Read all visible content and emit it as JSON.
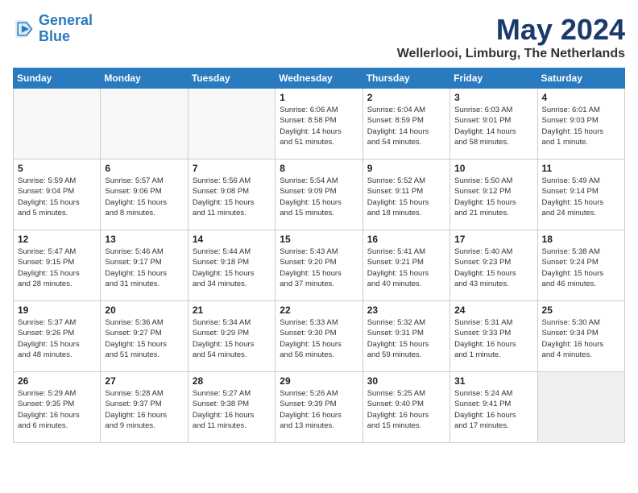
{
  "logo": {
    "line1": "General",
    "line2": "Blue"
  },
  "title": "May 2024",
  "location": "Wellerlooi, Limburg, The Netherlands",
  "headers": [
    "Sunday",
    "Monday",
    "Tuesday",
    "Wednesday",
    "Thursday",
    "Friday",
    "Saturday"
  ],
  "weeks": [
    [
      {
        "day": "",
        "info": "",
        "empty": true
      },
      {
        "day": "",
        "info": "",
        "empty": true
      },
      {
        "day": "",
        "info": "",
        "empty": true
      },
      {
        "day": "1",
        "info": "Sunrise: 6:06 AM\nSunset: 8:58 PM\nDaylight: 14 hours\nand 51 minutes."
      },
      {
        "day": "2",
        "info": "Sunrise: 6:04 AM\nSunset: 8:59 PM\nDaylight: 14 hours\nand 54 minutes."
      },
      {
        "day": "3",
        "info": "Sunrise: 6:03 AM\nSunset: 9:01 PM\nDaylight: 14 hours\nand 58 minutes."
      },
      {
        "day": "4",
        "info": "Sunrise: 6:01 AM\nSunset: 9:03 PM\nDaylight: 15 hours\nand 1 minute."
      }
    ],
    [
      {
        "day": "5",
        "info": "Sunrise: 5:59 AM\nSunset: 9:04 PM\nDaylight: 15 hours\nand 5 minutes."
      },
      {
        "day": "6",
        "info": "Sunrise: 5:57 AM\nSunset: 9:06 PM\nDaylight: 15 hours\nand 8 minutes."
      },
      {
        "day": "7",
        "info": "Sunrise: 5:56 AM\nSunset: 9:08 PM\nDaylight: 15 hours\nand 11 minutes."
      },
      {
        "day": "8",
        "info": "Sunrise: 5:54 AM\nSunset: 9:09 PM\nDaylight: 15 hours\nand 15 minutes."
      },
      {
        "day": "9",
        "info": "Sunrise: 5:52 AM\nSunset: 9:11 PM\nDaylight: 15 hours\nand 18 minutes."
      },
      {
        "day": "10",
        "info": "Sunrise: 5:50 AM\nSunset: 9:12 PM\nDaylight: 15 hours\nand 21 minutes."
      },
      {
        "day": "11",
        "info": "Sunrise: 5:49 AM\nSunset: 9:14 PM\nDaylight: 15 hours\nand 24 minutes."
      }
    ],
    [
      {
        "day": "12",
        "info": "Sunrise: 5:47 AM\nSunset: 9:15 PM\nDaylight: 15 hours\nand 28 minutes."
      },
      {
        "day": "13",
        "info": "Sunrise: 5:46 AM\nSunset: 9:17 PM\nDaylight: 15 hours\nand 31 minutes."
      },
      {
        "day": "14",
        "info": "Sunrise: 5:44 AM\nSunset: 9:18 PM\nDaylight: 15 hours\nand 34 minutes."
      },
      {
        "day": "15",
        "info": "Sunrise: 5:43 AM\nSunset: 9:20 PM\nDaylight: 15 hours\nand 37 minutes."
      },
      {
        "day": "16",
        "info": "Sunrise: 5:41 AM\nSunset: 9:21 PM\nDaylight: 15 hours\nand 40 minutes."
      },
      {
        "day": "17",
        "info": "Sunrise: 5:40 AM\nSunset: 9:23 PM\nDaylight: 15 hours\nand 43 minutes."
      },
      {
        "day": "18",
        "info": "Sunrise: 5:38 AM\nSunset: 9:24 PM\nDaylight: 15 hours\nand 46 minutes."
      }
    ],
    [
      {
        "day": "19",
        "info": "Sunrise: 5:37 AM\nSunset: 9:26 PM\nDaylight: 15 hours\nand 48 minutes."
      },
      {
        "day": "20",
        "info": "Sunrise: 5:36 AM\nSunset: 9:27 PM\nDaylight: 15 hours\nand 51 minutes."
      },
      {
        "day": "21",
        "info": "Sunrise: 5:34 AM\nSunset: 9:29 PM\nDaylight: 15 hours\nand 54 minutes."
      },
      {
        "day": "22",
        "info": "Sunrise: 5:33 AM\nSunset: 9:30 PM\nDaylight: 15 hours\nand 56 minutes."
      },
      {
        "day": "23",
        "info": "Sunrise: 5:32 AM\nSunset: 9:31 PM\nDaylight: 15 hours\nand 59 minutes."
      },
      {
        "day": "24",
        "info": "Sunrise: 5:31 AM\nSunset: 9:33 PM\nDaylight: 16 hours\nand 1 minute."
      },
      {
        "day": "25",
        "info": "Sunrise: 5:30 AM\nSunset: 9:34 PM\nDaylight: 16 hours\nand 4 minutes."
      }
    ],
    [
      {
        "day": "26",
        "info": "Sunrise: 5:29 AM\nSunset: 9:35 PM\nDaylight: 16 hours\nand 6 minutes."
      },
      {
        "day": "27",
        "info": "Sunrise: 5:28 AM\nSunset: 9:37 PM\nDaylight: 16 hours\nand 9 minutes."
      },
      {
        "day": "28",
        "info": "Sunrise: 5:27 AM\nSunset: 9:38 PM\nDaylight: 16 hours\nand 11 minutes."
      },
      {
        "day": "29",
        "info": "Sunrise: 5:26 AM\nSunset: 9:39 PM\nDaylight: 16 hours\nand 13 minutes."
      },
      {
        "day": "30",
        "info": "Sunrise: 5:25 AM\nSunset: 9:40 PM\nDaylight: 16 hours\nand 15 minutes."
      },
      {
        "day": "31",
        "info": "Sunrise: 5:24 AM\nSunset: 9:41 PM\nDaylight: 16 hours\nand 17 minutes."
      },
      {
        "day": "",
        "info": "",
        "empty": true,
        "shaded": true
      }
    ]
  ]
}
